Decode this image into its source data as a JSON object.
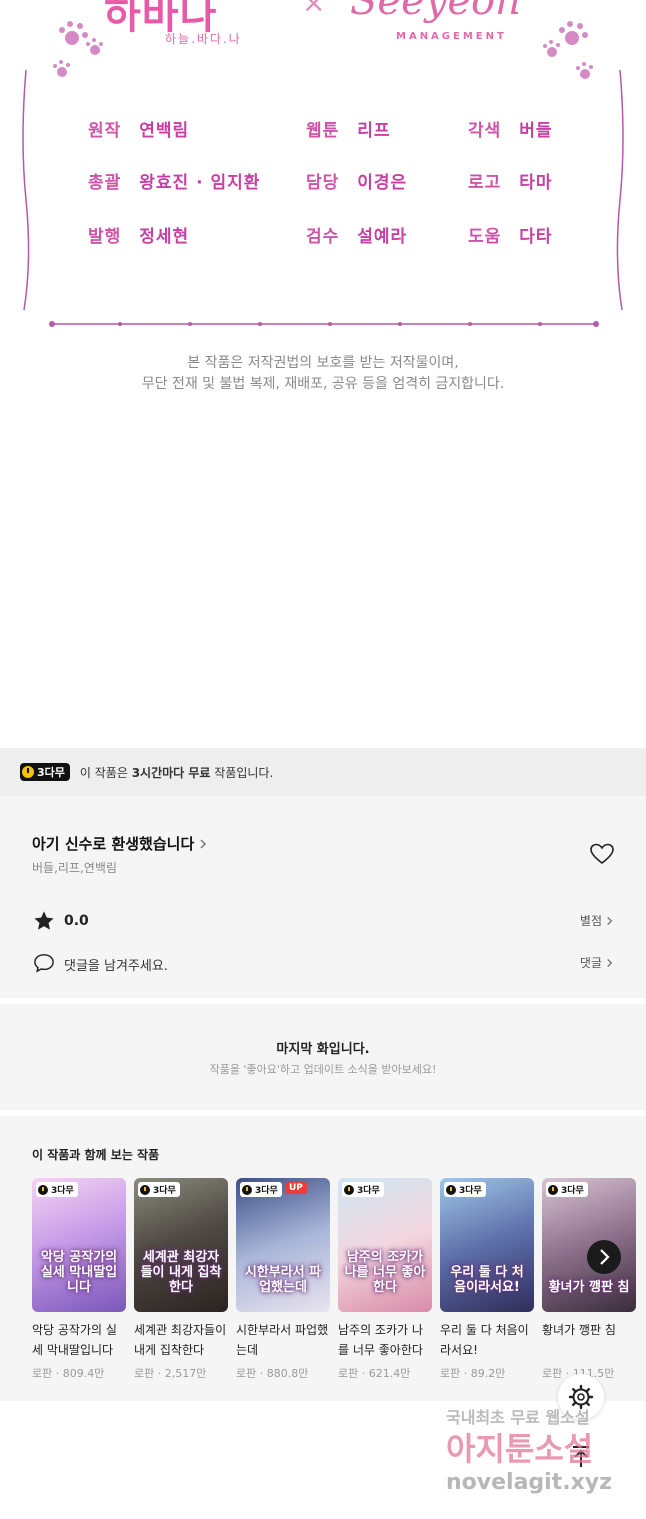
{
  "credits": {
    "logo_left": "하바나",
    "logo_left_sub": "하늘.바다.나",
    "logo_x": "×",
    "logo_right": "Seeyeon",
    "logo_right_sub": "MANAGEMENT",
    "rows": [
      [
        {
          "role": "원작",
          "name": "연백림"
        },
        {
          "role": "웹툰",
          "name": "리프"
        },
        {
          "role": "각색",
          "name": "버들"
        }
      ],
      [
        {
          "role": "총괄",
          "name": "왕효진 · 임지환"
        },
        {
          "role": "담당",
          "name": "이경은"
        },
        {
          "role": "로고",
          "name": "타마"
        }
      ],
      [
        {
          "role": "발행",
          "name": "정세현"
        },
        {
          "role": "검수",
          "name": "설예라"
        },
        {
          "role": "도움",
          "name": "다타"
        }
      ]
    ],
    "notice_line1": "본 작품은 저작권법의 보호를 받는 저작물이며,",
    "notice_line2": "무단 전재 및 불법 복제, 재배포, 공유 등을 엄격히 금지합니다."
  },
  "free_bar": {
    "badge": "3다무",
    "text_prefix": "이 작품은 ",
    "text_bold": "3시간마다 무료",
    "text_suffix": " 작품입니다."
  },
  "work": {
    "title": "아기 신수로 환생했습니다",
    "authors": "버들,리프,연백림",
    "rating": "0.0",
    "rating_link": "별점",
    "comment_prompt": "댓글을 남겨주세요.",
    "comment_link": "댓글"
  },
  "last_episode": {
    "title": "마지막 화입니다.",
    "subtitle": "작품을 '좋아요'하고 업데이트 소식을 받아보세요!"
  },
  "recommend": {
    "heading": "이 작품과 함께 보는 작품",
    "items": [
      {
        "badge": "3다무",
        "cover_text": "악당 공작가의 실세 막내딸입니다",
        "title": "악당 공작가의 실세 막내딸입니다",
        "meta": "로판 · 809.4만",
        "up": ""
      },
      {
        "badge": "3다무",
        "cover_text": "세계관 최강자들이 내게 집착한다",
        "title": "세계관 최강자들이 내게 집착한다",
        "meta": "로판 · 2,517만",
        "up": ""
      },
      {
        "badge": "3다무",
        "cover_text": "시한부라서 파업했는데",
        "title": "시한부라서 파업했는데",
        "meta": "로판 · 880.8만",
        "up": "UP"
      },
      {
        "badge": "3다무",
        "cover_text": "남주의 조카가 나를 너무 좋아한다",
        "title": "남주의 조카가 나를 너무 좋아한다",
        "meta": "로판 · 621.4만",
        "up": ""
      },
      {
        "badge": "3다무",
        "cover_text": "우리 둘 다 처음이라서요!",
        "title": "우리 둘 다 처음이라서요!",
        "meta": "로판 · 89.2만",
        "up": ""
      },
      {
        "badge": "3다무",
        "cover_text": "황녀가 깽판 침",
        "title": "황녀가 깽판 침",
        "meta": "로판 · 111.5만",
        "up": ""
      }
    ]
  },
  "watermark": {
    "line1": "국내최초 무료 웹소설",
    "line2": "아지툰소설",
    "line3": "novelagit.xyz"
  },
  "colors": {
    "credit_pink": "#c83fa4",
    "badge_yellow": "#f3c500",
    "panel_bg": "#f5f5f5"
  }
}
